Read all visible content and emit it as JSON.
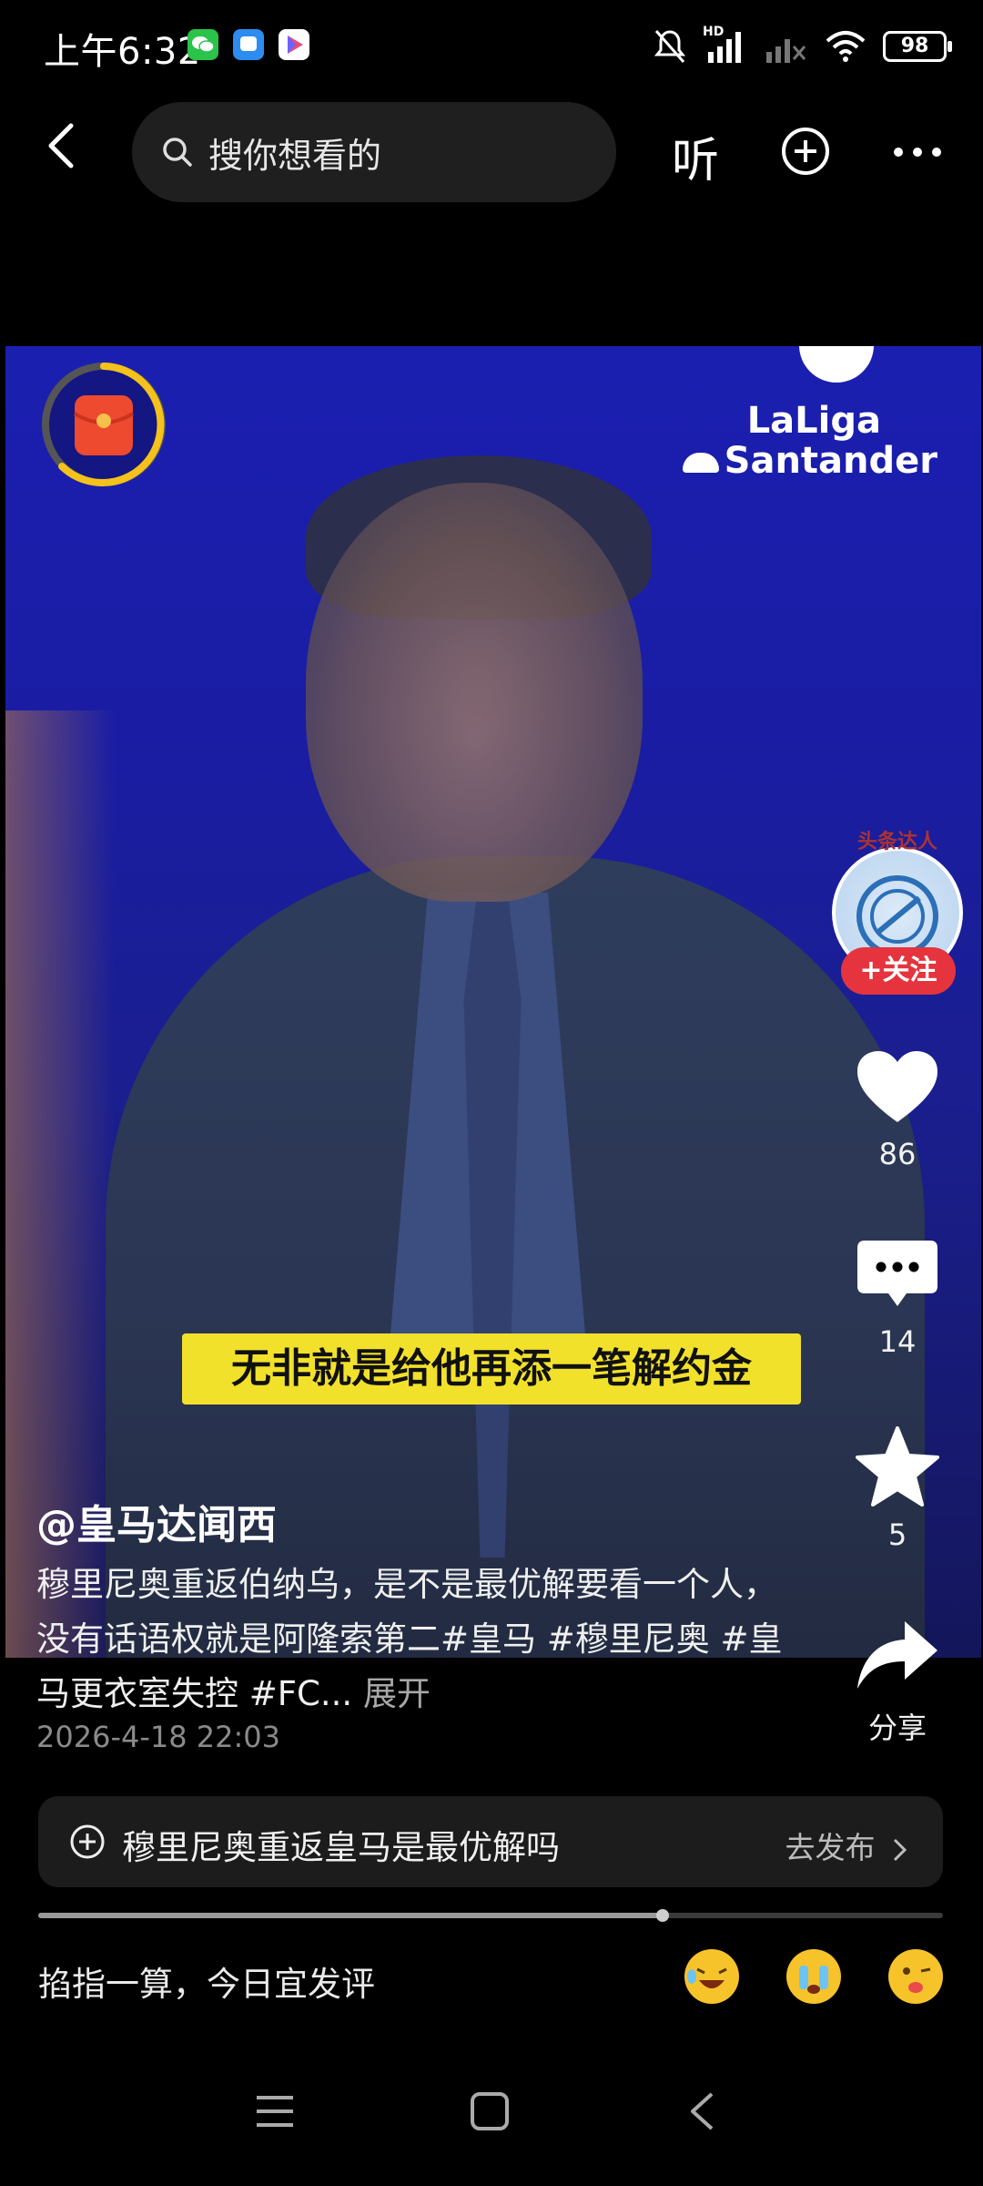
{
  "status_bar": {
    "time": "上午6:32",
    "network_label": "HD",
    "battery": "98",
    "app_icons": [
      "wechat-icon",
      "messages-icon",
      "play-store-icon"
    ]
  },
  "top_nav": {
    "search_placeholder": "搜你想看的",
    "listen_label": "听"
  },
  "video": {
    "league_logo_line1": "LaLiga",
    "league_logo_line2": "Santander",
    "subtitle": "无非就是给他再添一笔解约金"
  },
  "side_actions": {
    "creator_badge": "头条达人",
    "follow_label": "+关注",
    "likes": "86",
    "comments": "14",
    "favorites": "5",
    "share_label": "分享"
  },
  "post": {
    "author": "@皇马达闻西",
    "description": "穆里尼奥重返伯纳乌，是不是最优解要看一个人，没有话语权就是阿隆索第二#皇马 #穆里尼奥 #皇马更衣室失控 #FC...",
    "expand_label": "展开",
    "date": "2026-4-18 22:03"
  },
  "topic_bar": {
    "topic": "穆里尼奥重返皇马是最优解吗",
    "action": "去发布"
  },
  "playback": {
    "progress_fraction": 0.69
  },
  "comment_bar": {
    "prompt": "掐指一算，今日宜发评",
    "emojis": [
      "laughing-tears-emoji",
      "crying-emoji",
      "winking-tongue-emoji"
    ]
  },
  "colors": {
    "background": "#000000",
    "video_blue": "#1a1da3",
    "subtitle_yellow": "#f2e12b",
    "follow_red": "#e5343d",
    "redbag_ring": "#f4c21b"
  }
}
